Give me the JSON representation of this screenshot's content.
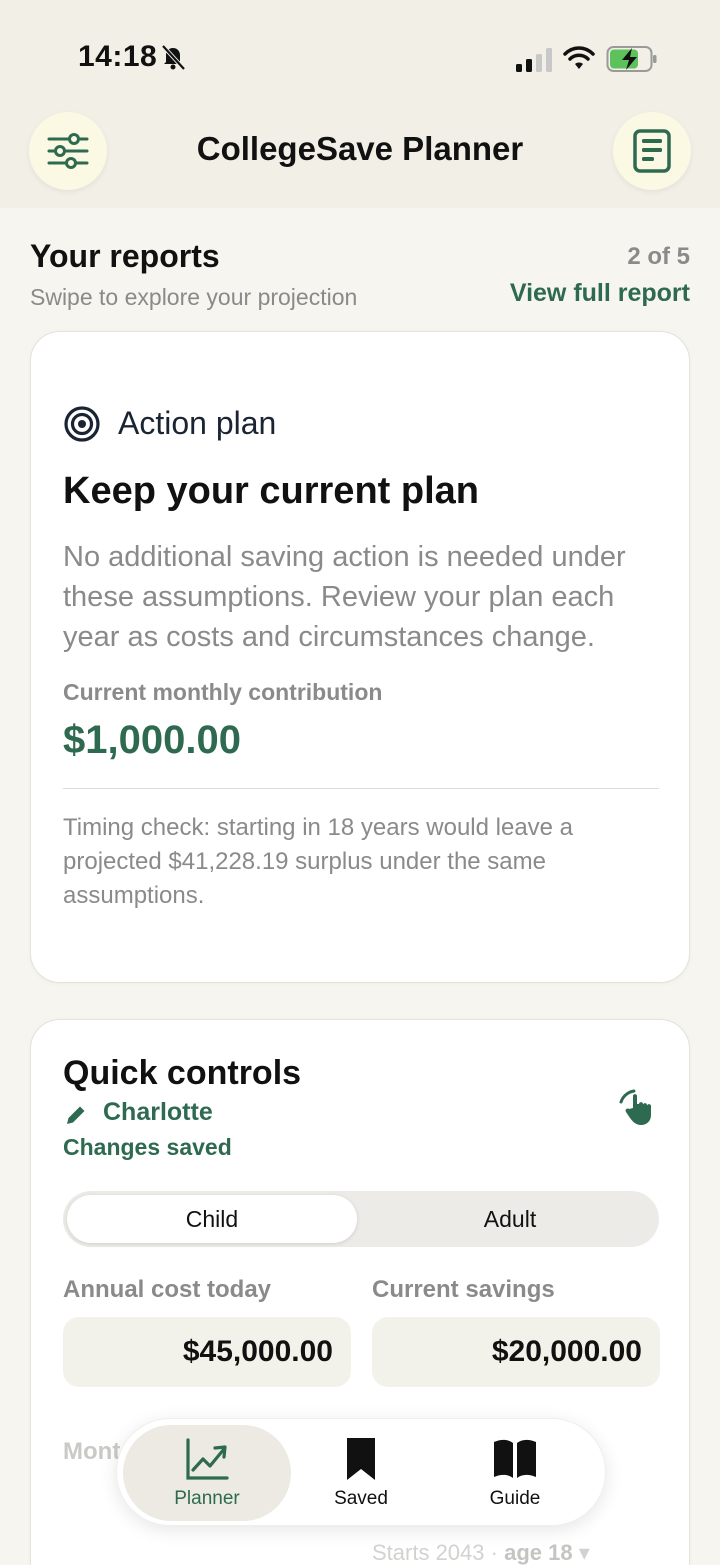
{
  "status_bar": {
    "time": "14:18"
  },
  "header": {
    "title": "CollegeSave Planner"
  },
  "reports": {
    "title": "Your reports",
    "subtitle": "Swipe to explore your projection",
    "counter": "2 of 5",
    "view_full_link": "View full report"
  },
  "action_card": {
    "section_label": "Action plan",
    "heading": "Keep your current plan",
    "body": "No additional saving action is needed under these assumptions. Review your plan each year as costs and circumstances change.",
    "contribution_label": "Current monthly contribution",
    "contribution_value": "$1,000.00",
    "timing_note": "Timing check: starting in 18 years would leave a projected $41,228.19 surplus under the same assumptions."
  },
  "quick_controls": {
    "title": "Quick controls",
    "profile_name": "Charlotte",
    "save_status": "Changes saved",
    "segments": [
      "Child",
      "Adult"
    ],
    "selected_segment": "Child",
    "fields": [
      {
        "label": "Annual cost today",
        "value": "$45,000.00"
      },
      {
        "label": "Current savings",
        "value": "$20,000.00"
      }
    ],
    "partial_label": "Mont",
    "partial_sub_prefix": "Starts 2043 ·",
    "partial_sub_age": "age 18"
  },
  "tabbar": {
    "items": [
      {
        "label": "Planner",
        "icon": "chart-trend-icon",
        "active": true
      },
      {
        "label": "Saved",
        "icon": "bookmark-icon",
        "active": false
      },
      {
        "label": "Guide",
        "icon": "book-icon",
        "active": false
      }
    ]
  },
  "colors": {
    "accent": "#2e6a4f",
    "background": "#f7f5ef",
    "muted": "#8a8a8a"
  }
}
